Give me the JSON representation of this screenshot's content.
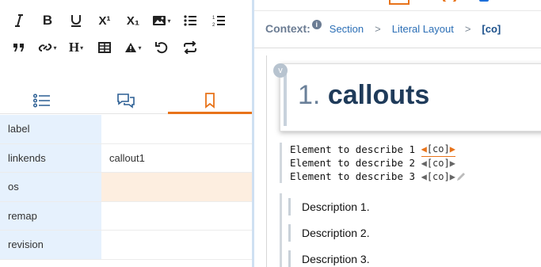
{
  "toolbar": {
    "row1": [
      "italic-icon",
      "bold-icon",
      "underline-icon",
      "superscript-icon",
      "subscript-icon",
      "image-icon",
      "bullet-list-icon",
      "numbered-list-icon"
    ],
    "row2": [
      "quote-icon",
      "link-icon",
      "heading-icon",
      "table-icon",
      "admonition-icon",
      "undo-icon",
      "redo-icon"
    ],
    "bold": "B",
    "heading": "H",
    "superscript": "X¹",
    "subscript": "X₁"
  },
  "tabs": [
    {
      "name": "outline",
      "icon": "list-icon",
      "active": false
    },
    {
      "name": "comments",
      "icon": "comments-icon",
      "active": false
    },
    {
      "name": "attributes",
      "icon": "bookmark-icon",
      "active": true
    }
  ],
  "attributes": [
    {
      "name": "label",
      "value": ""
    },
    {
      "name": "linkends",
      "value": "callout1"
    },
    {
      "name": "os",
      "value": ""
    },
    {
      "name": "remap",
      "value": ""
    },
    {
      "name": "revision",
      "value": ""
    }
  ],
  "context": {
    "label": "Context:",
    "info": "i",
    "crumbs": [
      "Section",
      "Literal Layout",
      "[co]"
    ],
    "separator": ">"
  },
  "document": {
    "title_number": "1.",
    "title_text": "callouts",
    "collapse": "v",
    "code_lines": [
      {
        "text": "Element to describe 1 ",
        "tag": "[co]"
      },
      {
        "text": "Element to describe 2 ",
        "tag": "[co]"
      },
      {
        "text": "Element to describe 3 ",
        "tag": "[co]"
      }
    ],
    "descriptions": [
      "Description 1.",
      "Description 2.",
      "Description 3."
    ]
  },
  "accent_color": "#e8731a",
  "attr_highlight_color": "#fdeee0"
}
